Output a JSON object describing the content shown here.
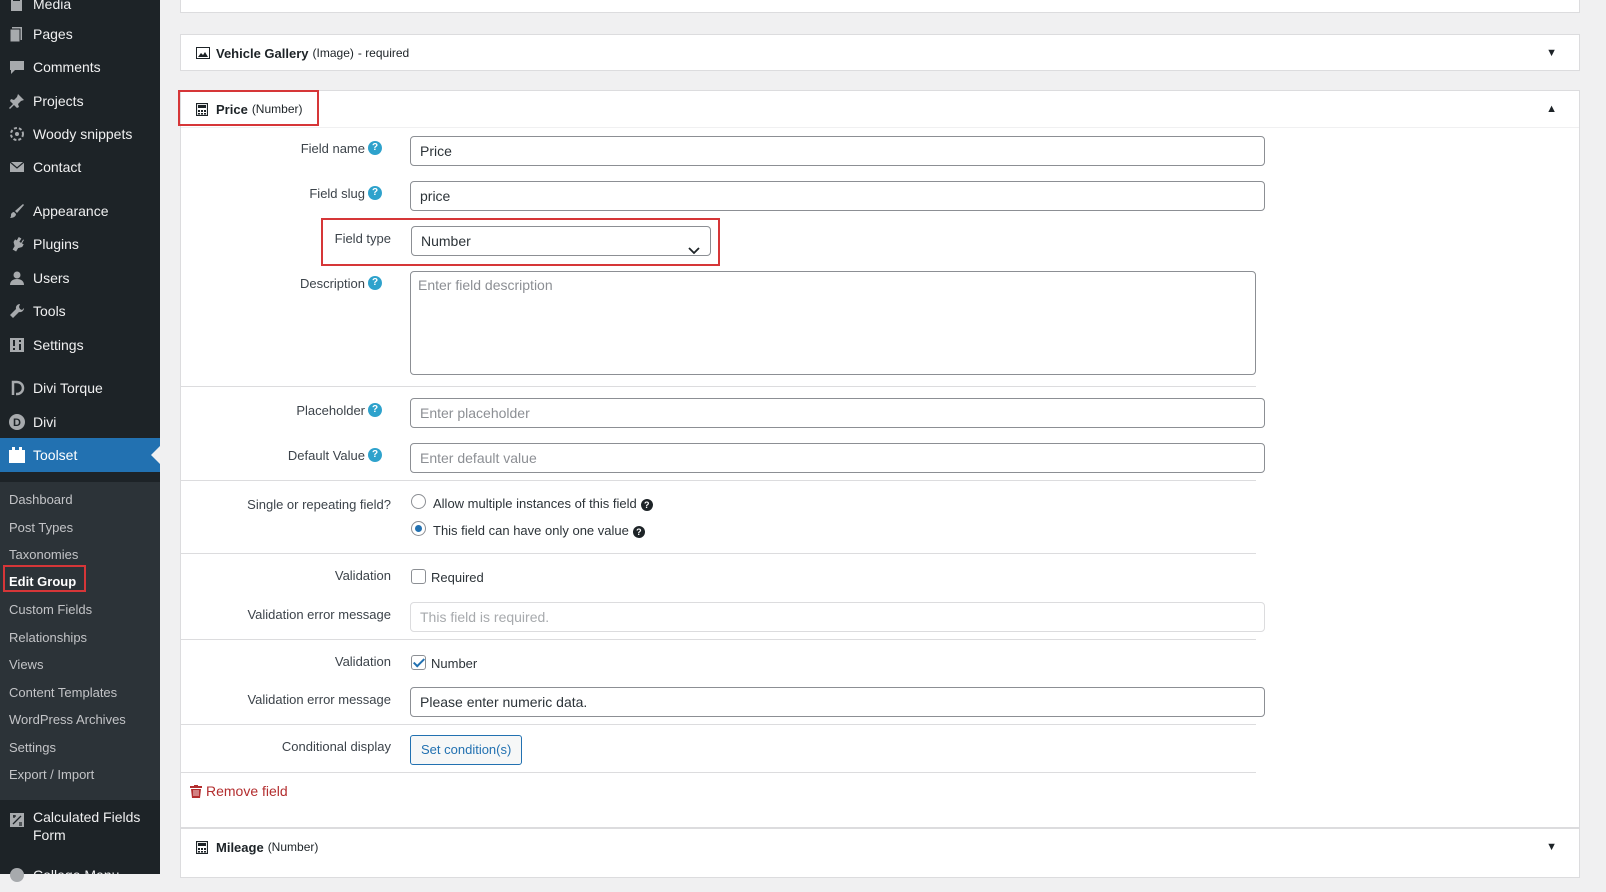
{
  "sidebar": {
    "items": [
      {
        "label": "Media",
        "icon": "media-icon"
      },
      {
        "label": "Pages",
        "icon": "pages-icon"
      },
      {
        "label": "Comments",
        "icon": "comments-icon"
      },
      {
        "label": "Projects",
        "icon": "pin-icon"
      },
      {
        "label": "Woody snippets",
        "icon": "snippets-icon"
      },
      {
        "label": "Contact",
        "icon": "mail-icon"
      },
      {
        "label": "Appearance",
        "icon": "brush-icon"
      },
      {
        "label": "Plugins",
        "icon": "plugin-icon"
      },
      {
        "label": "Users",
        "icon": "user-icon"
      },
      {
        "label": "Tools",
        "icon": "wrench-icon"
      },
      {
        "label": "Settings",
        "icon": "settings-icon"
      },
      {
        "label": "Divi Torque",
        "icon": "divi-torque-icon"
      },
      {
        "label": "Divi",
        "icon": "divi-icon"
      },
      {
        "label": "Toolset",
        "icon": "toolset-icon"
      }
    ],
    "submenu": [
      "Dashboard",
      "Post Types",
      "Taxonomies",
      "Edit Group",
      "Custom Fields",
      "Relationships",
      "Views",
      "Content Templates",
      "WordPress Archives",
      "Settings",
      "Export / Import"
    ],
    "bottom_item": {
      "line1": "Calculated Fields",
      "line2": "Form",
      "icon": "calculator-icon"
    },
    "cut_item": "College Menu"
  },
  "panels": {
    "gallery": {
      "title": "Vehicle Gallery",
      "type": "(Image)",
      "suffix": "- required"
    },
    "price": {
      "title": "Price",
      "type": "(Number)"
    },
    "mileage": {
      "title": "Mileage",
      "type": "(Number)"
    }
  },
  "form": {
    "field_name": {
      "label": "Field name",
      "value": "Price"
    },
    "field_slug": {
      "label": "Field slug",
      "value": "price"
    },
    "field_type": {
      "label": "Field type",
      "value": "Number"
    },
    "description": {
      "label": "Description",
      "placeholder": "Enter field description"
    },
    "placeholder": {
      "label": "Placeholder",
      "placeholder": "Enter placeholder"
    },
    "default_value": {
      "label": "Default Value",
      "placeholder": "Enter default value"
    },
    "repeat": {
      "label": "Single or repeating field?",
      "opt1": "Allow multiple instances of this field",
      "opt2": "This field can have only one value"
    },
    "validation1": {
      "label": "Validation",
      "option": "Required",
      "msg_label": "Validation error message",
      "msg": "This field is required."
    },
    "validation2": {
      "label": "Validation",
      "option": "Number",
      "msg_label": "Validation error message",
      "msg": "Please enter numeric data."
    },
    "conditional": {
      "label": "Conditional display",
      "button": "Set condition(s)"
    },
    "remove": "Remove field"
  },
  "colors": {
    "accent": "#2271b1",
    "highlight": "#d63638",
    "danger": "#b32d2e",
    "help": "#2ea2cc"
  }
}
